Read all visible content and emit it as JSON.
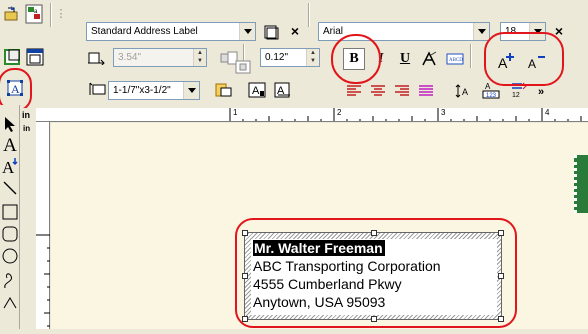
{
  "toolbar": {
    "label_type": "Standard Address Label",
    "font_name": "Arial",
    "font_size": "18",
    "width_value": "3.54\"",
    "spacing_value": "0.12\"",
    "label_size": "1-1/7\"x3-1/2\"",
    "bold_label": "B",
    "italic_label": "I",
    "underline_label": "U",
    "close_glyph": "×"
  },
  "ruler": {
    "unit": "in",
    "v_unit": "in",
    "marks": [
      "1",
      "2",
      "3",
      "4"
    ]
  },
  "label": {
    "lines": [
      "Mr. Walter Freeman",
      "ABC Transporting Corporation",
      "4555 Cumberland Pkwy",
      "Anytown, USA 95093"
    ]
  },
  "colors": {
    "highlight_ring": "#e0161c",
    "canvas": "#fbf6e1",
    "stamp": "#2a7a3a"
  }
}
